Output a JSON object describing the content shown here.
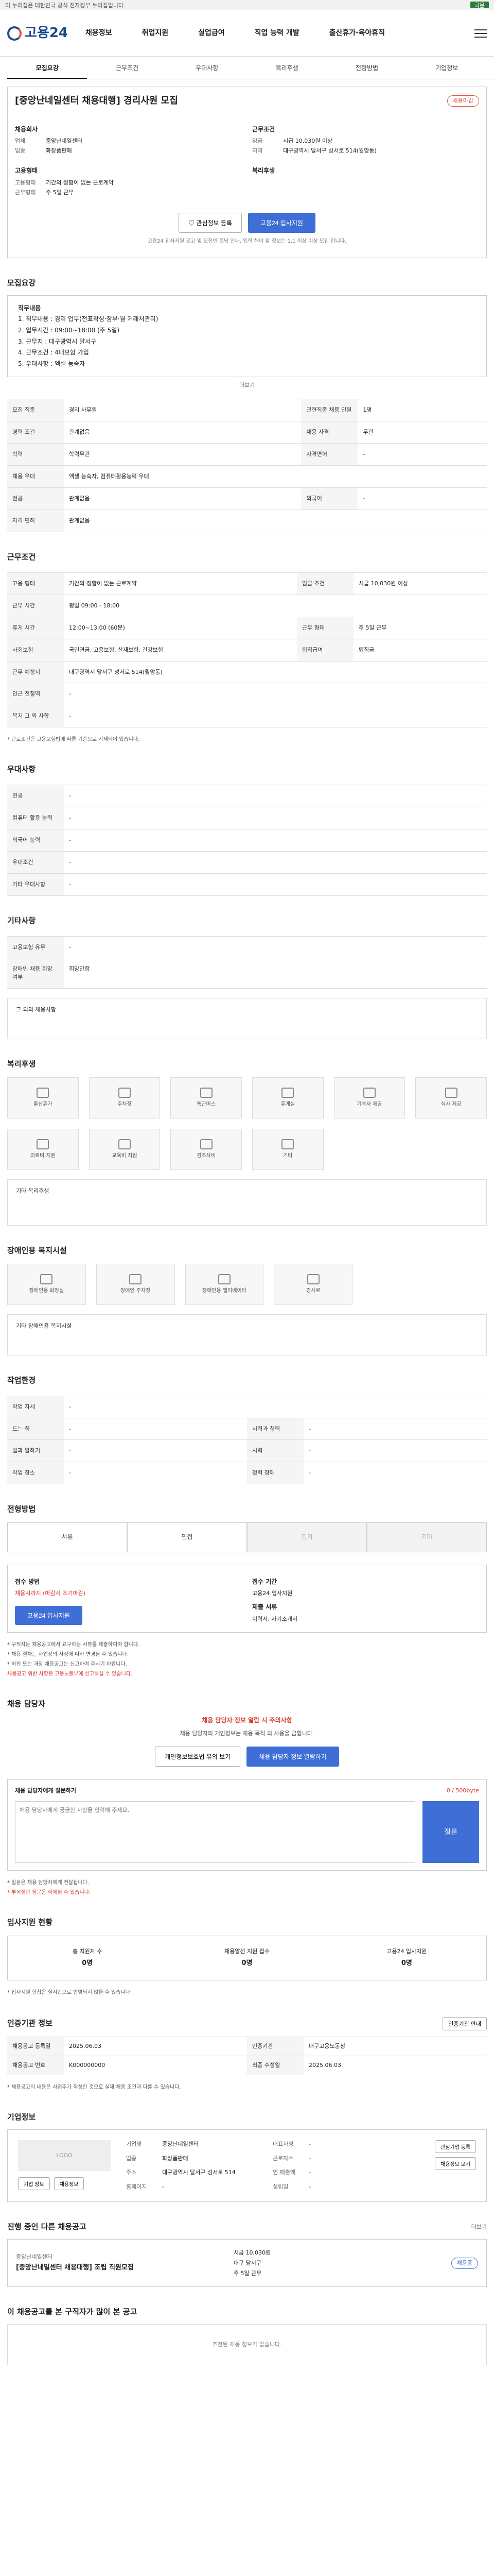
{
  "topbar": {
    "left": "이 누리집은 대한민국 공식 전자정부 누리집입니다.",
    "lang": "국문"
  },
  "header": {
    "logo": "고용24",
    "nav": [
      "채용정보",
      "취업지원",
      "실업급여",
      "직업 능력 개발",
      "출산휴가·육아휴직"
    ]
  },
  "tabs": [
    "모집요강",
    "근무조건",
    "우대사항",
    "복리후생",
    "전형방법",
    "기업정보"
  ],
  "job": {
    "title": "[중앙난네일센터 채용대행] 경리사원 모집",
    "badge": "채용마감",
    "company_h": "채용회사",
    "company_rows": [
      [
        "업체",
        "중앙난네일센터"
      ],
      [
        "업종",
        "화장품판매"
      ]
    ],
    "cond_h": "근무조건",
    "cond_rows": [
      [
        "임금",
        "시급 10,030원 이상"
      ],
      [
        "지역",
        "대구광역시 달서구 성서로 514(월암동)"
      ]
    ],
    "emp_h": "고용형태",
    "emp_rows": [
      [
        "고용형태",
        "기간의 정함이 없는 근로계약"
      ],
      [
        "근무형태",
        "주 5일 근무"
      ]
    ],
    "welfare_h": "복리후생",
    "save_btn": "관심정보 등록",
    "apply_btn": "고용24 입사지원",
    "apply_note": "고용24 입사지원 공고 및 모집인 응답 안내, 입력 해야 할 정보는 1.1 이상 이상 모집 합니다."
  },
  "recruit": {
    "h": "모집요강",
    "desc_h": "직무내용",
    "desc": [
      "1. 직무내용 : 경리 업무(전표작성·장부·월 거래처관리)",
      "2. 업무시간 : 09:00~18:00 (주 5일)",
      "3. 근무지 : 대구광역시 달서구",
      "4. 근무조건 : 4대보험 가입",
      "5. 우대사항 : 엑셀 능숙자"
    ],
    "more": "더보기",
    "rows": [
      [
        [
          "모집 직종",
          "경리 사무원"
        ],
        [
          "관련직종 채용 인원",
          "1명"
        ]
      ],
      [
        [
          "경력 조건",
          "관계없음"
        ],
        [
          "채용 자격",
          "무관"
        ]
      ],
      [
        [
          "학력",
          "학력무관"
        ],
        [
          "자격면허",
          "-"
        ]
      ],
      [
        [
          "채용 우대",
          "엑셀 능숙자, 컴퓨터활용능력 우대"
        ],
        [
          "",
          ""
        ]
      ],
      [
        [
          "전공",
          "관계없음"
        ],
        [
          "외국어",
          "-"
        ]
      ],
      [
        [
          "자격 면허",
          "관계없음"
        ],
        [
          "",
          ""
        ]
      ]
    ]
  },
  "work": {
    "h": "근무조건",
    "rows": [
      [
        [
          "고용 형태",
          "기간의 정함이 없는 근로계약"
        ],
        [
          "임금 조건",
          "시급 10,030원 이상"
        ]
      ],
      [
        [
          "근무 시간",
          "평일 09:00 - 18:00"
        ],
        [
          "",
          ""
        ]
      ],
      [
        [
          "휴게 시간",
          "12:00~13:00 (60분)"
        ],
        [
          "근무 형태",
          "주 5일 근무"
        ]
      ],
      [
        [
          "사회보험",
          "국민연금, 고용보험, 산재보험, 건강보험"
        ],
        [
          "퇴직급여",
          "퇴직금"
        ]
      ],
      [
        [
          "근무 예정지",
          "대구광역시 달서구 성서로 514(월암동)"
        ],
        [
          "",
          ""
        ]
      ],
      [
        [
          "인근 전철역",
          "-"
        ],
        [
          "",
          ""
        ]
      ],
      [
        [
          "복지 그 외 사항",
          "-"
        ],
        [
          "",
          ""
        ]
      ]
    ],
    "note": "* 근로조건은 고용보험법에 따른 기준으로 기재되어 있습니다."
  },
  "pref": {
    "h": "우대사항",
    "rows": [
      [
        "전공",
        "-"
      ],
      [
        "컴퓨터 활용 능력",
        "-"
      ],
      [
        "외국어 능력",
        "-"
      ],
      [
        "우대조건",
        "-"
      ],
      [
        "기타 우대사항",
        "-"
      ]
    ]
  },
  "etc": {
    "h": "기타사항",
    "rows": [
      [
        "고용보험 유무",
        "-"
      ],
      [
        "장애인 채용 희망 여부",
        "희망안함"
      ]
    ],
    "note": "그 외의 채용사항"
  },
  "welfare": {
    "h": "복리후생",
    "items": [
      "출산휴가",
      "주차장",
      "통근버스",
      "휴게실",
      "기숙사 제공",
      "식사 제공",
      "의료비 지원",
      "교육비 지원",
      "경조사비",
      "기타"
    ],
    "note": "기타 복리후생"
  },
  "disability": {
    "h": "장애인용 복지시설",
    "items": [
      "장애인용 화장실",
      "장애인 주차장",
      "장애인용 엘리베이터",
      "경사로"
    ],
    "note": "기타 장애인용 복지시설"
  },
  "env": {
    "h": "작업환경",
    "rows": [
      [
        [
          "작업 자세",
          "-"
        ],
        [
          "",
          ""
        ]
      ],
      [
        [
          "드는 힘",
          "-"
        ],
        [
          "시력과 청력",
          "-"
        ]
      ],
      [
        [
          "일과 말하기",
          "-"
        ],
        [
          "시력",
          "-"
        ]
      ],
      [
        [
          "작업 장소",
          "-"
        ],
        [
          "청력 장애",
          "-"
        ]
      ]
    ]
  },
  "process": {
    "h": "전형방법",
    "steps": [
      "서류",
      "면접",
      "필기",
      "기타"
    ],
    "apply_h": "접수 방법",
    "apply_v": "고용24 입사지원",
    "period_h": "접수 기간",
    "period_v": "채용시까지 (마감시 조기마감)",
    "docs_h": "제출 서류",
    "docs_v": "이력서, 자기소개서",
    "apply_button": "고용24 입사지원",
    "bullets": [
      "* 구직자는 채용공고에서 요구하는 서류를 제출하여야 합니다.",
      "* 채용 절차는 사업장의 사정에 따라 변경될 수 있습니다.",
      "* 허위 또는 과장 채용공고는 신고하여 주시기 바랍니다."
    ],
    "warn": "채용공고 위반 사항은 고용노동부에 신고하실 수 있습니다."
  },
  "contact": {
    "h": "채용 담당자",
    "warn": "채용 담당자 정보 열람 시 주의사항",
    "desc": "채용 담당자의 개인정보는 채용 목적 외 사용을 금합니다.",
    "btn1": "개인정보보호법 유의 보기",
    "btn2": "채용 담당자 정보 열람하기",
    "qa_h": "채용 담당자에게 질문하기",
    "qa_placeholder": "채용 담당자에게 궁금한 사항을 입력해 주세요.",
    "qa_btn": "질문",
    "qa_count": "0 / 500byte",
    "qa_notes": [
      "* 질문은 채용 담당자에게 전달됩니다.",
      "* 부적절한 질문은 삭제될 수 있습니다."
    ]
  },
  "status": {
    "h": "입사지원 현황",
    "cols": [
      [
        "총 지원자 수",
        "0명"
      ],
      [
        "채용알선 지원 접수",
        "0명"
      ],
      [
        "고용24 입사지원",
        "0명"
      ]
    ],
    "note": "* 입사지원 현황은 실시간으로 반영되지 않을 수 있습니다."
  },
  "manager": {
    "h": "인증기관 정보",
    "btn": "인증기관 안내",
    "rows": [
      [
        "채용공고 등록일",
        "2025.06.03"
      ],
      [
        "인증기관",
        "대구고용노동청"
      ],
      [
        "채용공고 번호",
        "K000000000"
      ],
      [
        "최종 수정일",
        "2025.06.03"
      ]
    ],
    "notes": [
      "* 채용공고의 내용은 사업주가 작성한 것으로 실제 채용 조건과 다를 수 있습니다."
    ]
  },
  "company": {
    "h": "기업정보",
    "logo": "LOGO",
    "btn_a": "기업 정보",
    "btn_b": "채용정보",
    "rows": [
      [
        "기업명",
        "중앙난네일센터"
      ],
      [
        "대표자명",
        "-"
      ],
      [
        "업종",
        "화장품판매"
      ],
      [
        "근로자수",
        "-"
      ],
      [
        "주소",
        "대구광역시 달서구 성서로 514"
      ],
      [
        "연 매출액",
        "-"
      ],
      [
        "홈페이지",
        "-"
      ],
      [
        "설립일",
        "-"
      ]
    ],
    "side_btns": [
      "관심기업 등록",
      "채용정보 보기"
    ]
  },
  "similar": {
    "h": "진행 중인 다른 채용공고",
    "more": "더보기",
    "company": "중앙난네일센터",
    "title": "[중앙난네일센터 채용대행] 조립 직원모집",
    "meta": [
      "시급 10,030원",
      "대구 달서구",
      "주 5일 근무"
    ],
    "badge": "채용중"
  },
  "recommend": {
    "h": "이 채용공고를 본 구직자가 많이 본 공고",
    "empty": "추천된 채용 정보가 없습니다."
  }
}
